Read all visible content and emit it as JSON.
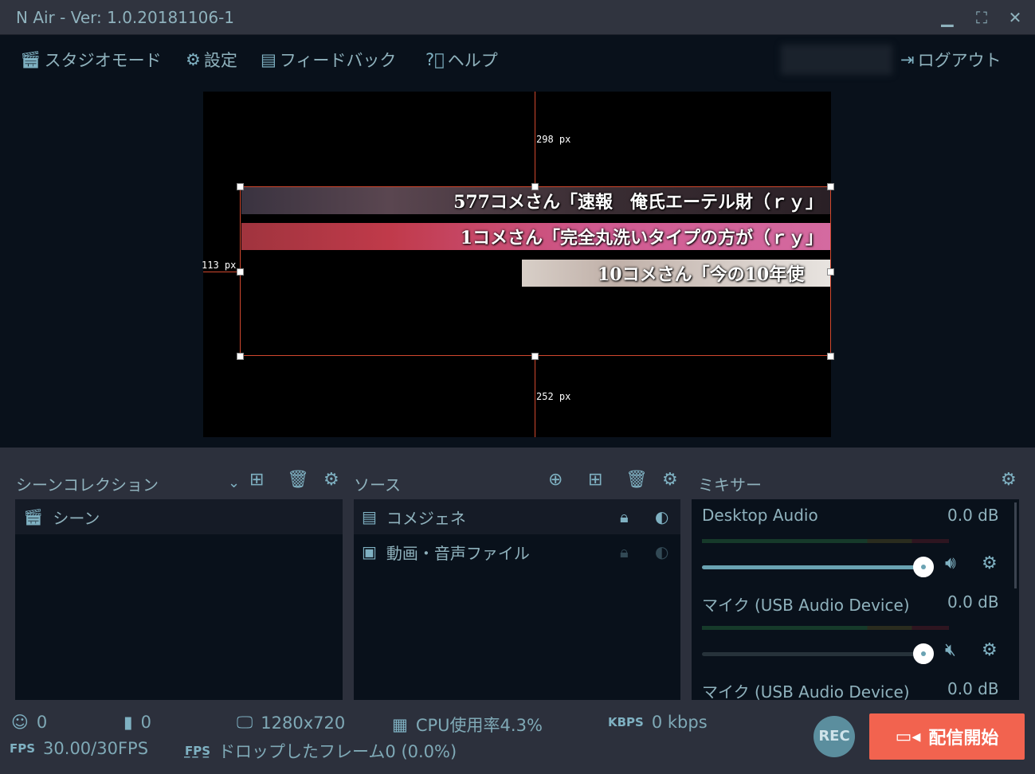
{
  "window": {
    "title": "N Air - Ver: 1.0.20181106-1",
    "minimize": "▁",
    "maximize": "⛶",
    "close": "✕"
  },
  "toolbar": {
    "studio_mode": "スタジオモード",
    "settings": "設定",
    "feedback": "フィードバック",
    "help": "ヘルプ",
    "logout": "ログアウト"
  },
  "preview": {
    "top_distance": "298 px",
    "left_distance": "113 px",
    "bottom_distance": "252 px",
    "comments": [
      "577コメさん「速報　俺氏エーテル財（ｒｙ」",
      "1コメさん「完全丸洗いタイプの方が（ｒｙ」",
      "10コメさん「今の10年使"
    ]
  },
  "scenes": {
    "title": "シーンコレクション",
    "items": [
      {
        "label": "シーン"
      }
    ]
  },
  "sources": {
    "title": "ソース",
    "items": [
      {
        "label": "コメジェネ"
      },
      {
        "label": "動画・音声ファイル"
      }
    ]
  },
  "mixer": {
    "title": "ミキサー",
    "items": [
      {
        "name": "Desktop Audio",
        "level": "0.0 dB",
        "volume": 1.0,
        "muted": false
      },
      {
        "name": "マイク (USB Audio Device)",
        "level": "0.0 dB",
        "volume": 1.0,
        "muted": true
      },
      {
        "name": "マイク (USB Audio Device)",
        "level": "0.0 dB"
      }
    ]
  },
  "status": {
    "viewers": "0",
    "comments": "0",
    "resolution": "1280x720",
    "cpu": "CPU使用率4.3%",
    "kbps_label": "KBPS",
    "kbps": "0 kbps",
    "fps_label": "FPS",
    "fps": "30.00/30FPS",
    "dropped": "ドロップしたフレーム0 (0.0%)"
  },
  "buttons": {
    "rec": "REC",
    "start_stream": "配信開始"
  },
  "colors": {
    "accent": "#7fb1c2",
    "stream_button": "#f2634f",
    "guide": "#d0482e"
  }
}
